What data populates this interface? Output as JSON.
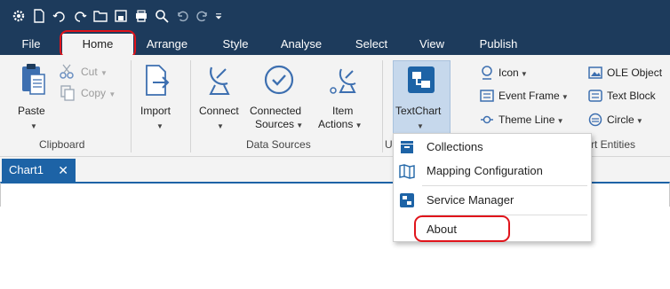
{
  "quick_access": {
    "icons": [
      "settings-icon",
      "new-file-icon",
      "undo-history-icon",
      "redo-history-icon",
      "open-folder-icon",
      "save-icon",
      "print-icon",
      "search-icon",
      "undo-icon",
      "redo-icon",
      "customize-dropdown-icon"
    ]
  },
  "menu": {
    "tabs": [
      "File",
      "Home",
      "Arrange",
      "Style",
      "Analyse",
      "Select",
      "View",
      "Publish"
    ],
    "active": "Home"
  },
  "ribbon": {
    "clipboard": {
      "paste": "Paste",
      "cut": "Cut",
      "copy": "Copy",
      "label": "Clipboard"
    },
    "import": {
      "label": "Import"
    },
    "data_sources": {
      "connect": "Connect",
      "connected_1": "Connected",
      "connected_2": "Sources",
      "item_1": "Item",
      "item_2": "Actions",
      "label": "Data Sources"
    },
    "textchart": {
      "label": "TextChart",
      "group_partial": "U"
    },
    "insert": {
      "icon": "Icon",
      "event_frame": "Event Frame",
      "theme_line": "Theme Line",
      "ole_object": "OLE Object",
      "text_block": "Text Block",
      "circle": "Circle",
      "label_partial": "rt Entities"
    }
  },
  "doc_tab": {
    "title": "Chart1",
    "close": "✕"
  },
  "dropdown": {
    "items": [
      "Collections",
      "Mapping Configuration",
      "Service Manager",
      "About"
    ]
  },
  "colors": {
    "titlebar": "#1d3b5c",
    "accent": "#1d63a6",
    "highlight": "#e0141b"
  }
}
